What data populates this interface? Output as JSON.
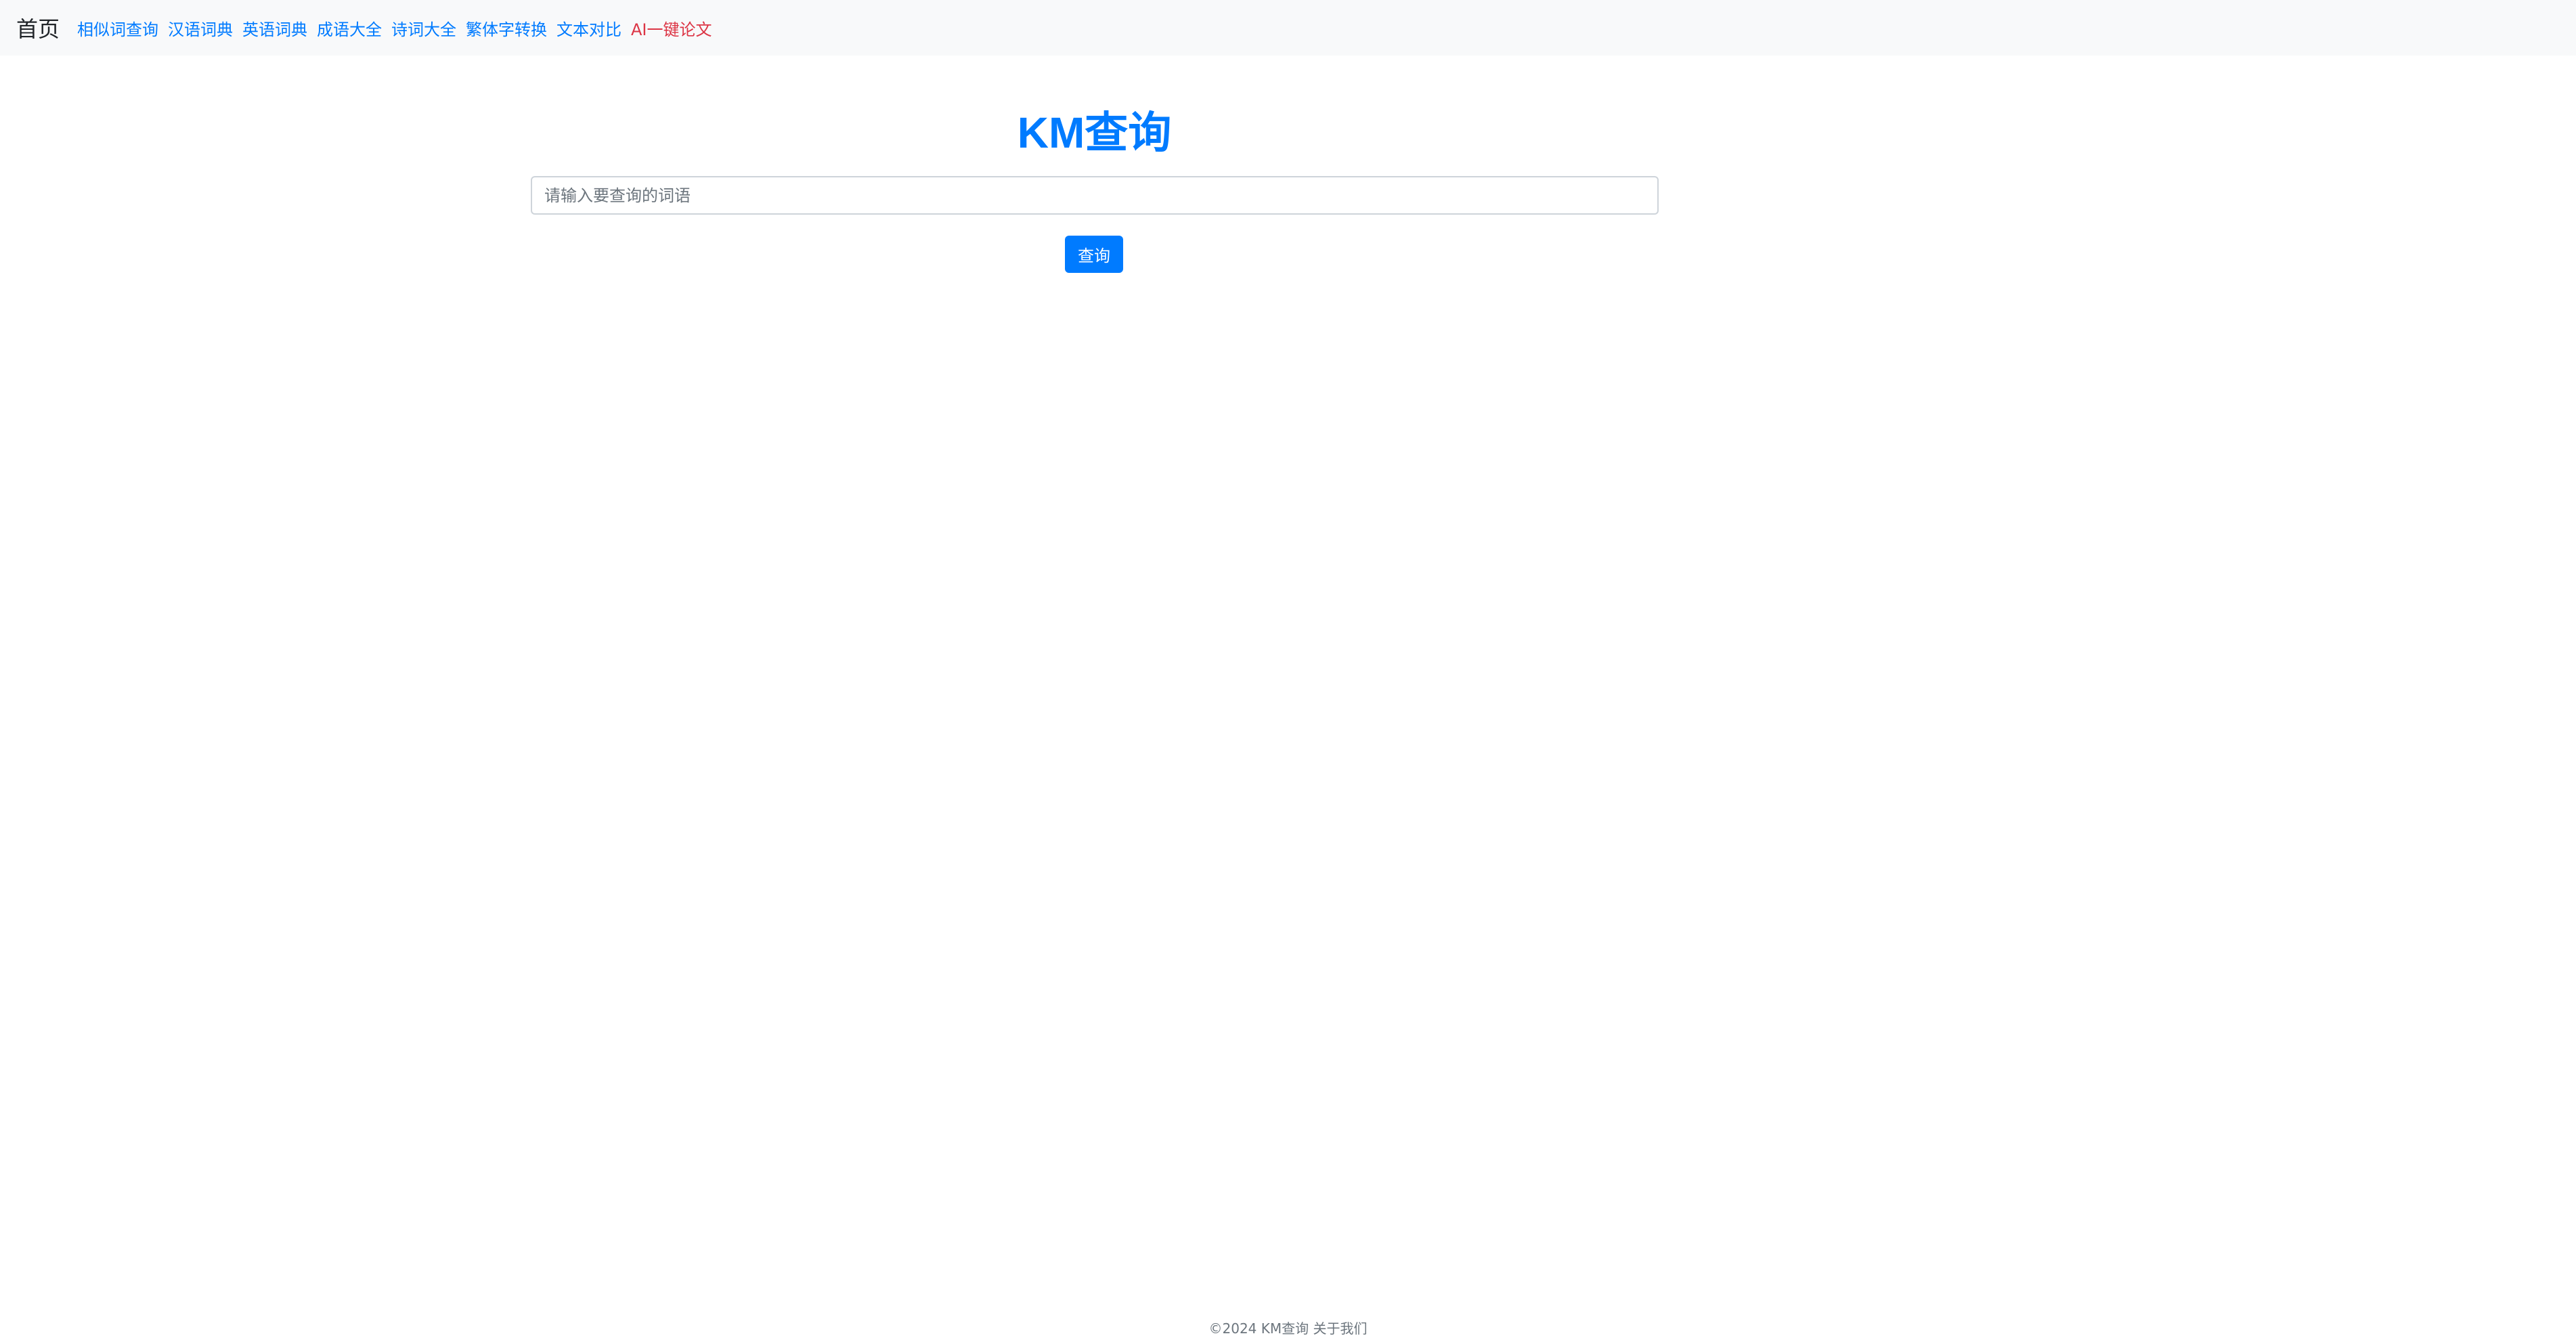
{
  "navbar": {
    "brand": "首页",
    "links": [
      {
        "label": "相似词查询",
        "color": "#007bff"
      },
      {
        "label": "汉语词典",
        "color": "#007bff"
      },
      {
        "label": "英语词典",
        "color": "#007bff"
      },
      {
        "label": "成语大全",
        "color": "#007bff"
      },
      {
        "label": "诗词大全",
        "color": "#007bff"
      },
      {
        "label": "繁体字转换",
        "color": "#007bff"
      },
      {
        "label": "文本对比",
        "color": "#007bff"
      },
      {
        "label": "AI一键论文",
        "color": "#dc3545"
      }
    ]
  },
  "main": {
    "title": "KM查询",
    "search": {
      "placeholder": "请输入要查询的词语",
      "value": ""
    },
    "search_button_label": "查询"
  },
  "footer": {
    "copyright": "©2024 KM查询",
    "about_label": "关于我们"
  },
  "colors": {
    "accent": "#007bff",
    "highlight": "#dc3545",
    "navbar_bg": "#f8f9fa"
  }
}
